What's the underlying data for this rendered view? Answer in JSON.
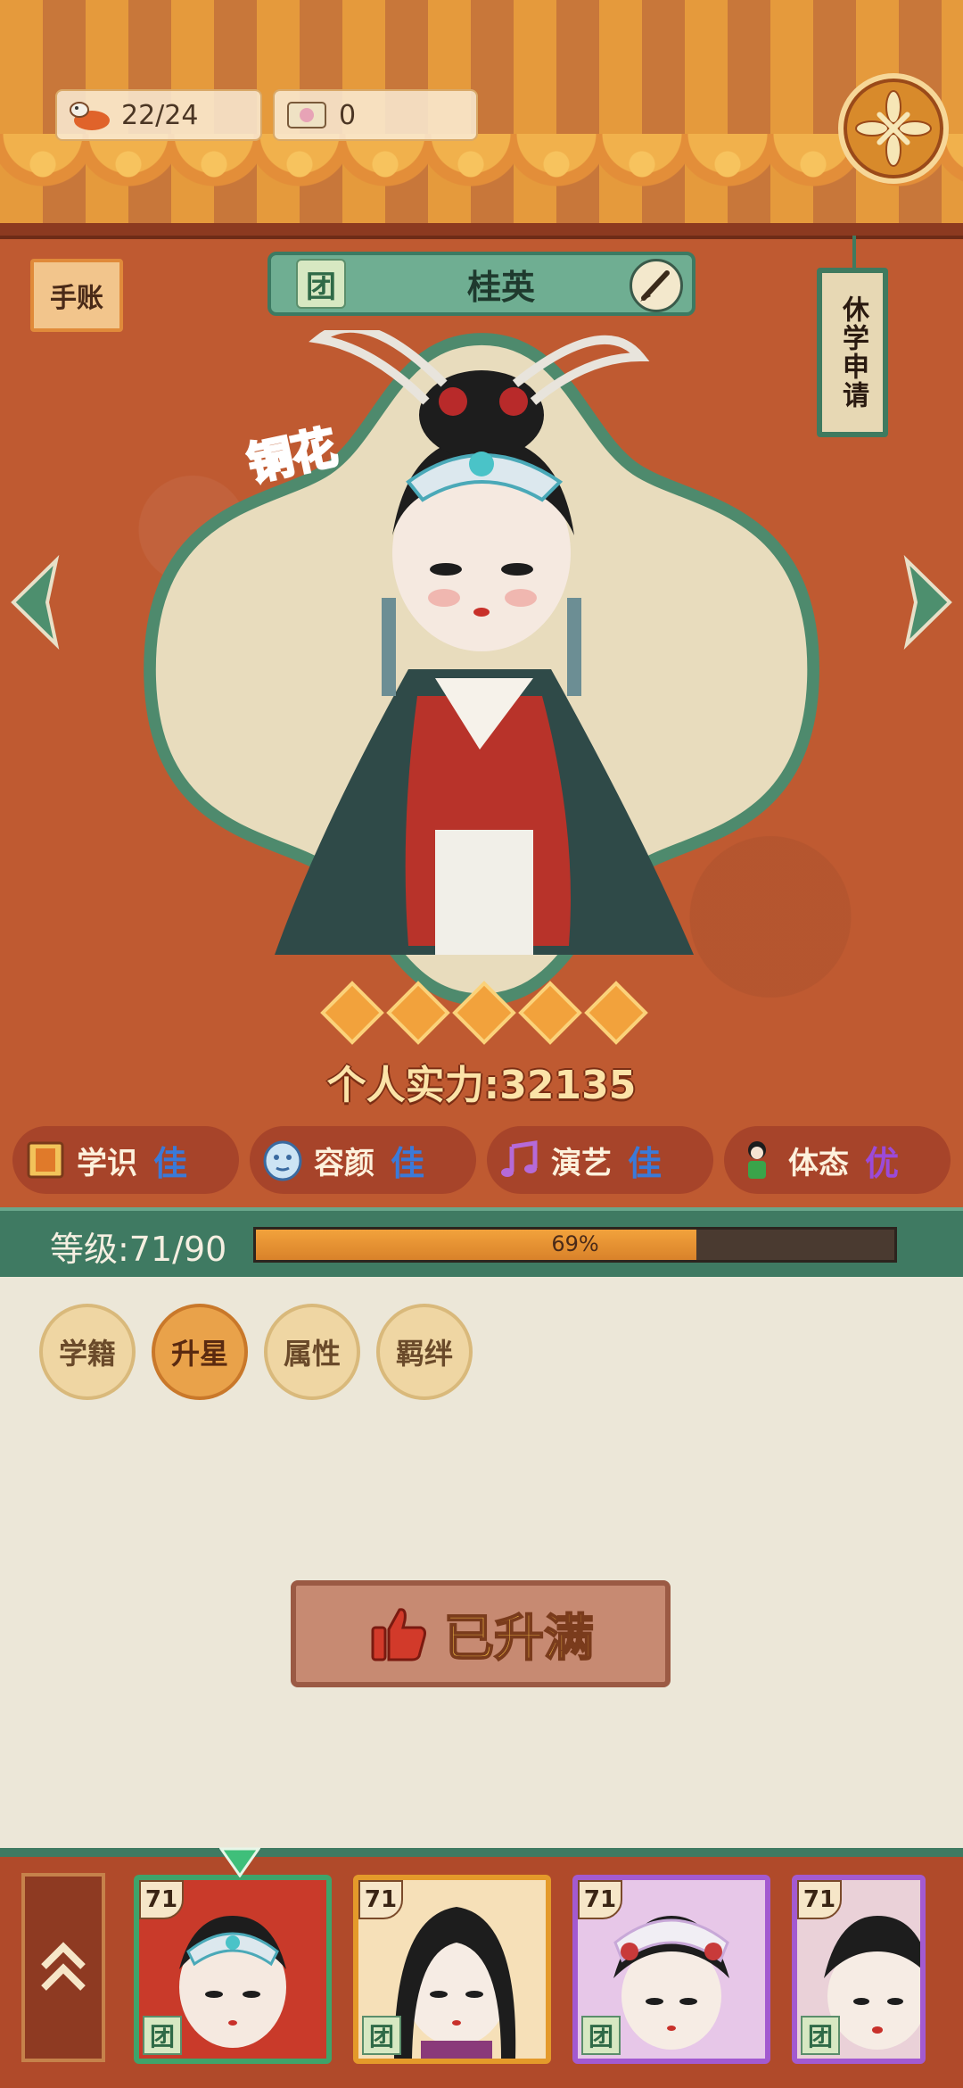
{
  "top": {
    "stamina": "22/24",
    "tickets": "0"
  },
  "header": {
    "notebook_label": "手账",
    "group_badge": "团",
    "character_name": "桂英",
    "leave_label": "休学申请"
  },
  "character": {
    "rank": "铜花",
    "stars": 5,
    "power_text": "个人实力:32135"
  },
  "attributes": [
    {
      "label": "学识",
      "grade": "佳",
      "grade_color": "#3a7ad9"
    },
    {
      "label": "容颜",
      "grade": "佳",
      "grade_color": "#3a7ad9"
    },
    {
      "label": "演艺",
      "grade": "佳",
      "grade_color": "#3a7ad9"
    },
    {
      "label": "体态",
      "grade": "优",
      "grade_color": "#9b4ad9"
    }
  ],
  "level": {
    "text": "等级:71/90",
    "progress": 0.69,
    "progress_label": "69%"
  },
  "tabs": [
    {
      "label": "学籍",
      "active": false
    },
    {
      "label": "升星",
      "active": true
    },
    {
      "label": "属性",
      "active": false
    },
    {
      "label": "羁绊",
      "active": false
    }
  ],
  "maxed_label": "已升满",
  "roster": [
    {
      "level": "71",
      "group": "团",
      "border": "#3fa36a",
      "bg": "#c93a2a"
    },
    {
      "level": "71",
      "group": "团",
      "border": "#e49a2a",
      "bg": "#f6e0b8"
    },
    {
      "level": "71",
      "group": "团",
      "border": "#a35ad0",
      "bg": "#e7c7e8"
    },
    {
      "level": "71",
      "group": "团",
      "border": "#a35ad0",
      "bg": "#ead1d8"
    }
  ],
  "colors": {
    "accent_green": "#3f7a62",
    "banner_orange": "#e59a3c",
    "panel_red": "#bf5a31"
  }
}
